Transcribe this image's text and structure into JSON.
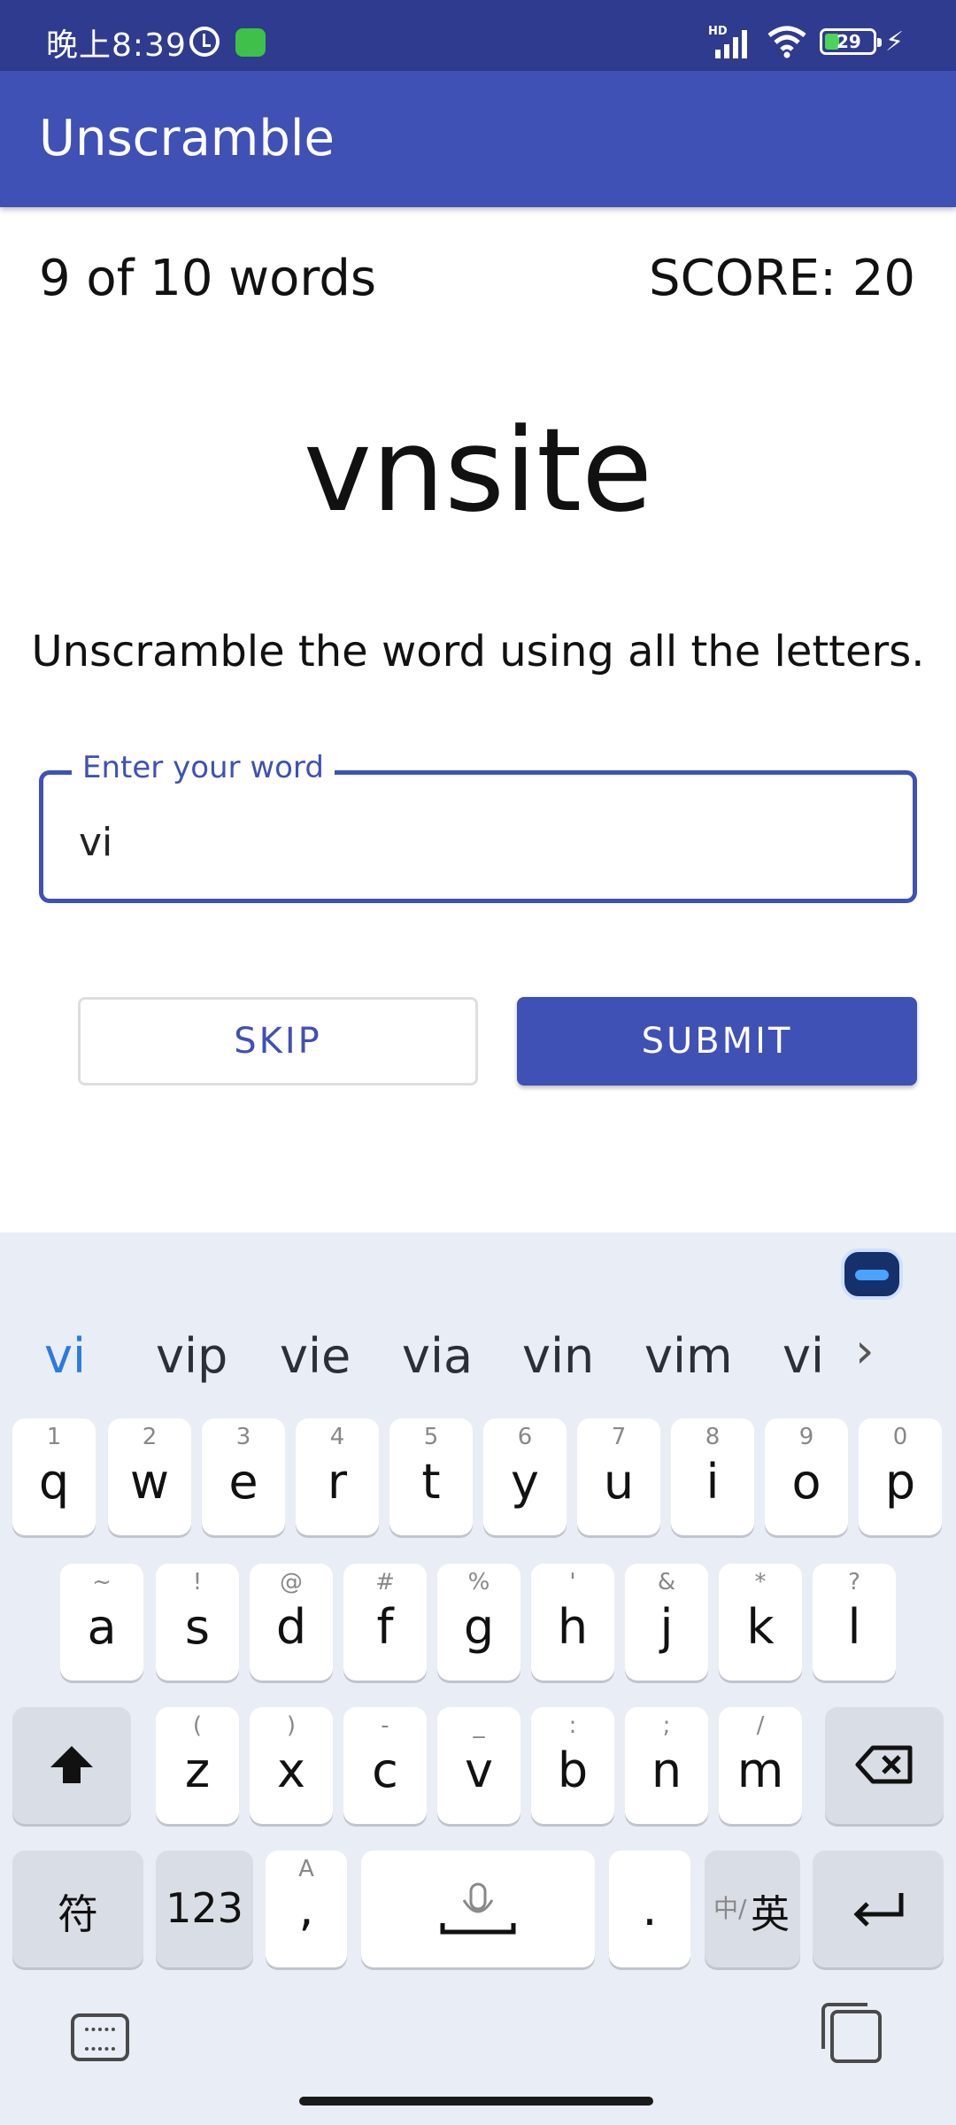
{
  "status_bar": {
    "time": "晚上8:39",
    "network": "HD",
    "battery": "29"
  },
  "app": {
    "title": "Unscramble"
  },
  "game": {
    "word_count": "9 of 10 words",
    "score": "SCORE: 20",
    "scrambled_word": "vnsite",
    "instructions": "Unscramble the word using all the letters."
  },
  "input": {
    "label": "Enter your word",
    "value": "vi"
  },
  "buttons": {
    "skip": "SKIP",
    "submit": "SUBMIT"
  },
  "keyboard": {
    "suggestions": [
      "vi",
      "vip",
      "vie",
      "via",
      "vin",
      "vim",
      "vi"
    ],
    "row1": [
      {
        "key": "q",
        "sub": "1"
      },
      {
        "key": "w",
        "sub": "2"
      },
      {
        "key": "e",
        "sub": "3"
      },
      {
        "key": "r",
        "sub": "4"
      },
      {
        "key": "t",
        "sub": "5"
      },
      {
        "key": "y",
        "sub": "6"
      },
      {
        "key": "u",
        "sub": "7"
      },
      {
        "key": "i",
        "sub": "8"
      },
      {
        "key": "o",
        "sub": "9"
      },
      {
        "key": "p",
        "sub": "0"
      }
    ],
    "row2": [
      {
        "key": "a",
        "sub": "~"
      },
      {
        "key": "s",
        "sub": "!"
      },
      {
        "key": "d",
        "sub": "@"
      },
      {
        "key": "f",
        "sub": "#"
      },
      {
        "key": "g",
        "sub": "%"
      },
      {
        "key": "h",
        "sub": "'"
      },
      {
        "key": "j",
        "sub": "&"
      },
      {
        "key": "k",
        "sub": "*"
      },
      {
        "key": "l",
        "sub": "?"
      }
    ],
    "row3": [
      {
        "key": "z",
        "sub": "("
      },
      {
        "key": "x",
        "sub": ")"
      },
      {
        "key": "c",
        "sub": "-"
      },
      {
        "key": "v",
        "sub": "_"
      },
      {
        "key": "b",
        "sub": ":"
      },
      {
        "key": "n",
        "sub": ";"
      },
      {
        "key": "m",
        "sub": "/"
      }
    ],
    "shift_icon": "shift-arrow-icon",
    "backspace_icon": "backspace-icon",
    "symbols": "符",
    "numbers": "123",
    "comma": ",",
    "comma_sub": "A",
    "space_icon": "microphone-icon",
    "period": ".",
    "lang_cn": "中/",
    "lang_en": "英",
    "enter_icon": "enter-return-icon"
  }
}
